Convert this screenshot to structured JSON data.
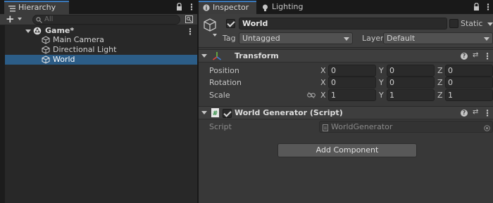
{
  "hierarchy": {
    "tab_label": "Hierarchy",
    "add_label": "+",
    "search_placeholder": "All",
    "scene_name": "Game*",
    "items": [
      {
        "label": "Main Camera"
      },
      {
        "label": "Directional Light"
      },
      {
        "label": "World",
        "selected": true
      }
    ]
  },
  "inspector": {
    "tabs": [
      {
        "label": "Inspector",
        "active": true
      },
      {
        "label": "Lighting",
        "active": false
      }
    ],
    "object": {
      "active": true,
      "name": "World",
      "static_label": "Static",
      "static": false,
      "tag_label": "Tag",
      "tag_value": "Untagged",
      "layer_label": "Layer",
      "layer_value": "Default"
    },
    "transform": {
      "title": "Transform",
      "rows": [
        {
          "label": "Position",
          "x": "0",
          "y": "0",
          "z": "0"
        },
        {
          "label": "Rotation",
          "x": "0",
          "y": "0",
          "z": "0"
        },
        {
          "label": "Scale",
          "x": "1",
          "y": "1",
          "z": "1"
        }
      ],
      "axis_x": "X",
      "axis_y": "Y",
      "axis_z": "Z"
    },
    "script_component": {
      "enabled": true,
      "title": "World Generator (Script)",
      "script_label": "Script",
      "script_value": "WorldGenerator"
    },
    "add_component_label": "Add Component"
  },
  "colors": {
    "selection": "#2c5d87",
    "tab_accent": "#3a79bb",
    "transform_axis_red": "#e0443c",
    "transform_axis_green": "#6dbb3e",
    "transform_axis_blue": "#3f7fd6"
  }
}
